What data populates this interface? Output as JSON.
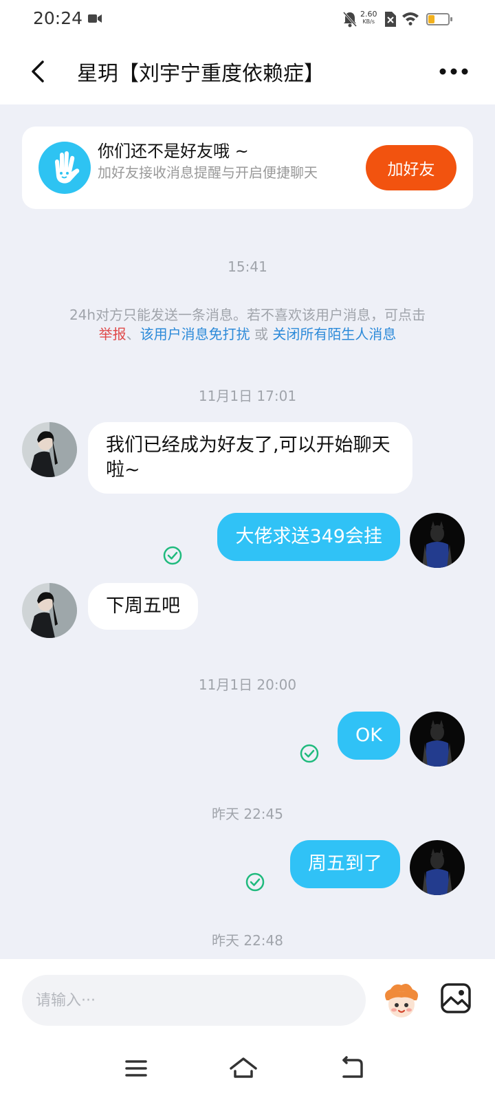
{
  "status_bar": {
    "time": "20:24",
    "net_speed_value": "2.60",
    "net_speed_unit": "KB/s"
  },
  "header": {
    "title": "星玥【刘宇宁重度依赖症】"
  },
  "friend_card": {
    "title": "你们还不是好友哦 ~",
    "subtitle": "加好友接收消息提醒与开启便捷聊天",
    "add_button": "加好友"
  },
  "notice": {
    "time": "15:41",
    "text_prefix": "24h对方只能发送一条消息。若不喜欢该用户消息，可点击",
    "link_report": "举报",
    "sep": "、",
    "link_dnd": "该用户消息免打扰",
    "or": " 或 ",
    "link_close_strangers": "关闭所有陌生人消息"
  },
  "messages": {
    "time1": "11月1日 17:01",
    "in1": "我们已经成为好友了,可以开始聊天啦~",
    "out1": "大佬求送349会挂",
    "in2": "下周五吧",
    "time2": "11月1日 20:00",
    "out2": "OK",
    "time3": "昨天 22:45",
    "out3": "周五到了",
    "time4_partial": "昨天 22:48"
  },
  "input": {
    "placeholder": "请输入···"
  },
  "colors": {
    "accent_blue": "#30c2f6",
    "add_friend_orange": "#f2530f",
    "sent_check_green": "#1fba7d",
    "report_red": "#e04a4a",
    "link_blue": "#2c8ad9"
  },
  "icons": [
    "back-icon",
    "more-icon",
    "hand-wave-icon",
    "sent-check-icon",
    "emoji-sticker-icon",
    "image-icon",
    "menu-icon",
    "home-icon",
    "back-nav-icon"
  ]
}
